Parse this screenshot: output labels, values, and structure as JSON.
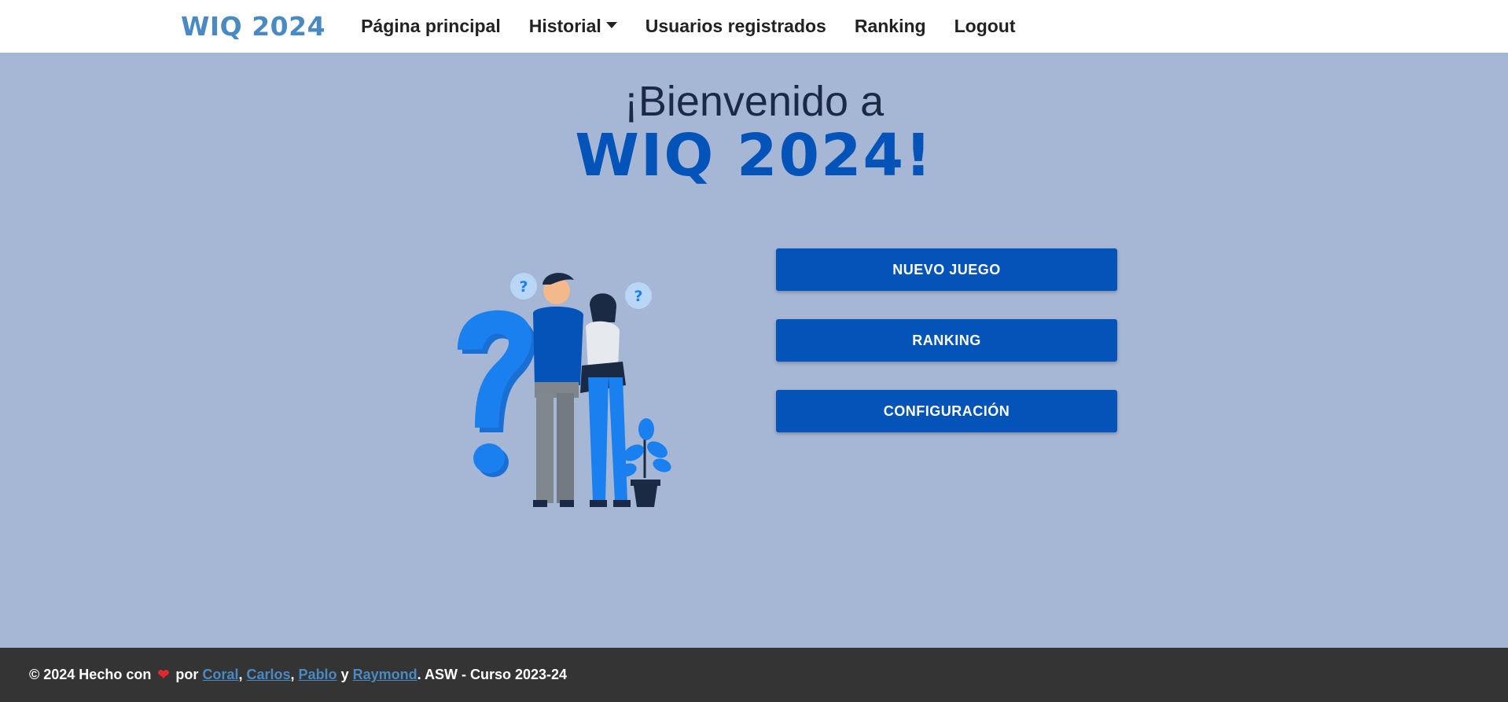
{
  "navbar": {
    "brand": "WIQ 2024",
    "items": [
      {
        "label": "Página principal"
      },
      {
        "label": "Historial"
      },
      {
        "label": "Usuarios registrados"
      },
      {
        "label": "Ranking"
      },
      {
        "label": "Logout"
      }
    ]
  },
  "hero": {
    "welcome": "¡Bienvenido a",
    "title": "WIQ 2024!"
  },
  "menu": {
    "new_game": "NUEVO JUEGO",
    "ranking": "RANKING",
    "settings": "CONFIGURACIÓN"
  },
  "footer": {
    "copyright": "© 2024 Hecho con",
    "by": "por",
    "authors": [
      "Coral",
      "Carlos",
      "Pablo",
      "Raymond"
    ],
    "sep1": ",",
    "sep2": ",",
    "and": "y",
    "course": ". ASW - Curso 2023-24"
  },
  "colors": {
    "background": "#a5b7d5",
    "primary": "#0353b8",
    "brand": "#4a8ac2",
    "footer": "#343434"
  }
}
